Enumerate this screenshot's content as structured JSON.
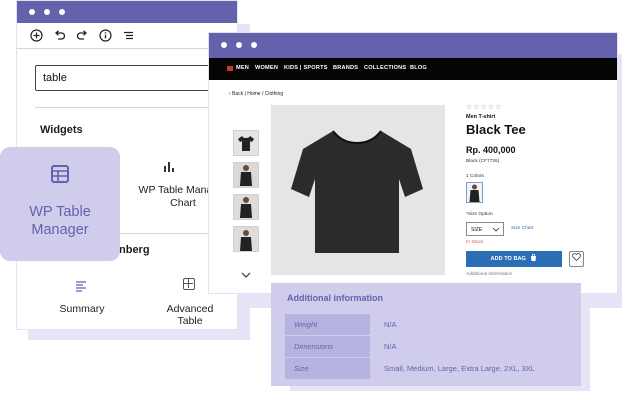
{
  "editor": {
    "toolbar_icons": [
      "plus-circle-icon",
      "undo-icon",
      "redo-icon",
      "info-icon",
      "list-view-icon"
    ],
    "search_value": "table",
    "widgets_heading": "Widgets",
    "chart_widget_label": "WP Table Manager Chart",
    "gutenberg_heading_partial": "nberg",
    "summary_label": "Summary",
    "advanced_table_label": "Advanced Table"
  },
  "wptm_card": {
    "label": "WP Table Manager",
    "icon": "table-icon"
  },
  "store": {
    "nav": [
      "MEN",
      "WOMEN",
      "KIDS | SPORTS",
      "BRANDS",
      "COLLECTIONS",
      "BLOG"
    ],
    "breadcrumb_back": "‹ Back",
    "breadcrumb_path": "Home / Clothing",
    "rating": "☆☆☆☆☆",
    "subtitle": "Men T-shirt",
    "title": "Black Tee",
    "price": "Rp. 400,000",
    "sku": "Black (CF7726)",
    "colors_label": "1 Colors",
    "size_option_label": "*Size Option",
    "size_select": "SIZE",
    "size_chart": "Size Chart",
    "stock": "In Stock",
    "add_to_bag": "ADD TO BAG",
    "add_info_link": "Additional Information"
  },
  "info_panel": {
    "heading": "Additional information",
    "rows": [
      {
        "key": "Weight",
        "value": "N/A"
      },
      {
        "key": "Dimensions",
        "value": "N/A"
      },
      {
        "key": "Size",
        "value": "Small, Medium, Large, Extra Large, 2XL, 3XL"
      }
    ]
  },
  "colors": {
    "brand": "#6461ad",
    "panel": "#cfccec",
    "button": "#2a6eb5"
  }
}
